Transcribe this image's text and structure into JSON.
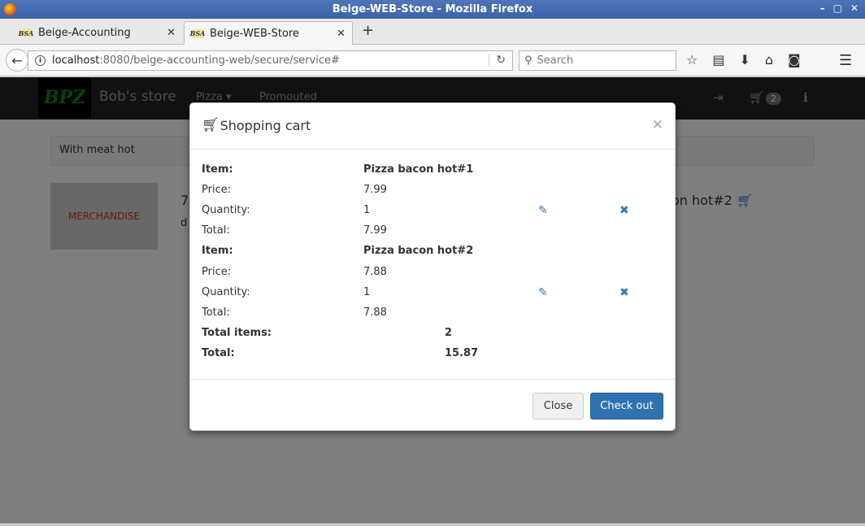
{
  "window": {
    "title": "Beige-WEB-Store - Mozilla Firefox",
    "buttons": [
      "–",
      "▢",
      "✕"
    ]
  },
  "tabs": [
    {
      "favicon": "BSA",
      "label": "Beige-Accounting",
      "close": "✕"
    },
    {
      "favicon": "BSA",
      "label": "Beige-WEB-Store",
      "close": "✕"
    }
  ],
  "newtab": "+",
  "url": {
    "host": "localhost",
    "rest": ":8080/beige-accounting-web/secure/service#"
  },
  "search": {
    "placeholder": "Search"
  },
  "site": {
    "logo": "BPZ",
    "brand": "Bob's store",
    "nav": [
      "Pizza ▾",
      "Promouted"
    ],
    "cart_count": "2"
  },
  "background": {
    "breadcrumb": "With meat hot",
    "merchandise": "MERCHANDISE",
    "item_partial_left": "7",
    "item_partial_desc": "d",
    "item_partial_right": "on hot#2"
  },
  "modal": {
    "title": "Shopping cart",
    "close": "×",
    "items": [
      {
        "item_label": "Item:",
        "item": "Pizza bacon hot#1",
        "price_label": "Price:",
        "price": "7.99",
        "quantity_label": "Quantity:",
        "quantity": "1",
        "total_label": "Total:",
        "total": "7.99"
      },
      {
        "item_label": "Item:",
        "item": "Pizza bacon hot#2",
        "price_label": "Price:",
        "price": "7.88",
        "quantity_label": "Quantity:",
        "quantity": "1",
        "total_label": "Total:",
        "total": "7.88"
      }
    ],
    "total_items_label": "Total items:",
    "total_items": "2",
    "grand_total_label": "Total:",
    "grand_total": "15.87",
    "close_button": "Close",
    "checkout_button": "Check out"
  }
}
